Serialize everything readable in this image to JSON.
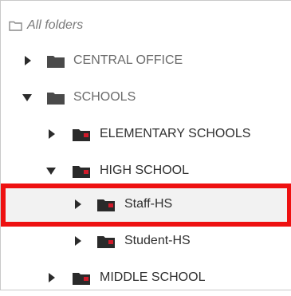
{
  "header": {
    "label": "All folders",
    "icon": "folder-outline-icon"
  },
  "tree": {
    "items": [
      {
        "label": "CENTRAL OFFICE",
        "expanded": false
      },
      {
        "label": "SCHOOLS",
        "expanded": true
      },
      {
        "label": "ELEMENTARY SCHOOLS",
        "expanded": false
      },
      {
        "label": "HIGH SCHOOL",
        "expanded": true
      },
      {
        "label": "Staff-HS",
        "expanded": false,
        "selected": true
      },
      {
        "label": "Student-HS",
        "expanded": false
      },
      {
        "label": "MIDDLE SCHOOL",
        "expanded": false
      }
    ]
  },
  "colors": {
    "folder_plain": "#4a4a4a",
    "folder_lock_badge": "#d11a2a",
    "highlight": "#ee1111",
    "text_muted": "#6b6b6b",
    "text_dark": "#2f2f2f"
  }
}
